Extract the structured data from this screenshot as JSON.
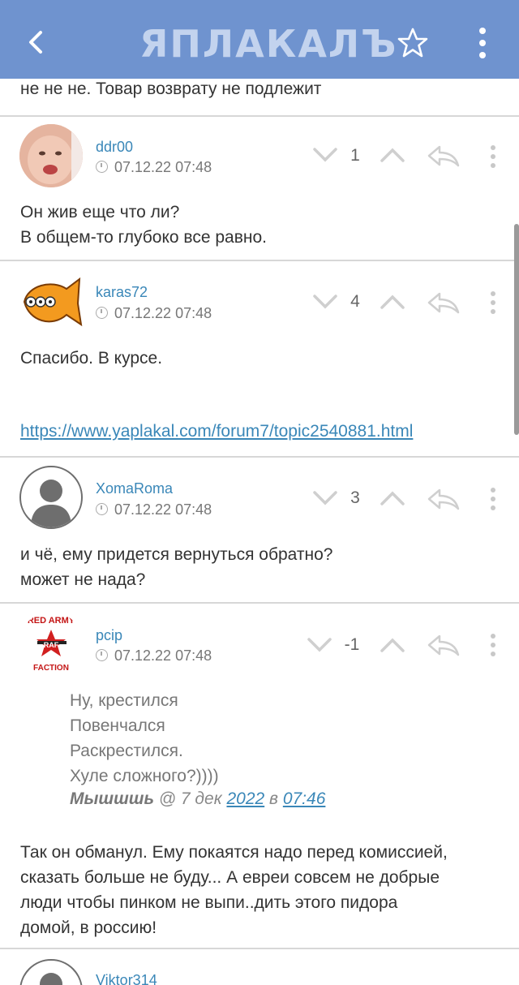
{
  "app": {
    "logo_text": "ЯПЛАКАЛЪ",
    "colors": {
      "header": "#6f93cf",
      "link": "#3a87b8"
    }
  },
  "toolbar": {
    "back_icon": "back-arrow-icon",
    "star_icon": "star-icon",
    "menu_icon": "more-vertical-icon"
  },
  "previous_post_tail": "не не не. Товар возврату не подлежит",
  "posts": [
    {
      "username": "ddr00",
      "date": "07.12.22 07:48",
      "score": "1",
      "lines": [
        "Он жив еще что ли?",
        "В общем-то глубоко все равно."
      ]
    },
    {
      "username": "karas72",
      "date": "07.12.22 07:48",
      "score": "4",
      "lines": [
        "Спасибо. В курсе."
      ],
      "link": "https://www.yaplakal.com/forum7/topic2540881.html"
    },
    {
      "username": "XomaRoma",
      "date": "07.12.22 07:48",
      "score": "3",
      "lines": [
        "и чё, ему придется вернуться обратно?",
        "может не нада?"
      ]
    },
    {
      "username": "pcip",
      "date": "07.12.22 07:48",
      "score": "-1",
      "avatar_text": {
        "top": "RED ARMY",
        "mid": "RAF",
        "bottom": "FACTION"
      },
      "quote_lines": [
        "Ну, крестился",
        "Повенчался",
        "Раскрестился.",
        "Хуле сложного?))))"
      ],
      "quote_author": "Мышшшь",
      "quote_at": " @ 7 дек ",
      "quote_year": "2022",
      "quote_in": " в ",
      "quote_time": "07:46",
      "lines": [
        "Так он обманул. Ему покаятся надо перед комиссией,",
        "сказать больше не буду... А евреи совсем не добрые",
        "люди чтобы пинком не выпи..дить этого пидора",
        "домой, в россию!"
      ]
    },
    {
      "username": "Viktor314"
    }
  ]
}
